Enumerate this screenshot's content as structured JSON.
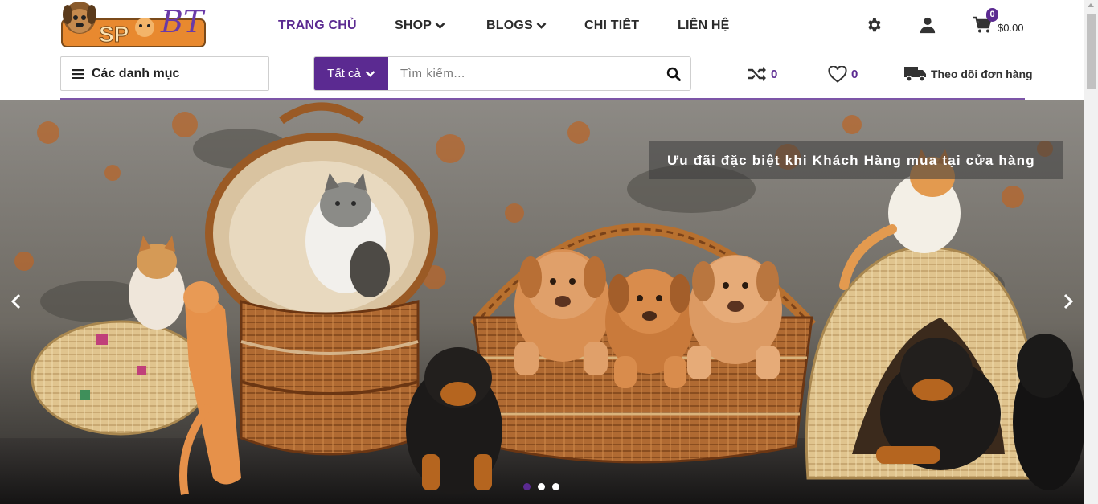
{
  "logo": {
    "text_left": "SP",
    "text_right": "BT"
  },
  "nav": {
    "items": [
      {
        "label": "TRANG CHỦ"
      },
      {
        "label": "SHOP"
      },
      {
        "label": "BLOGS"
      },
      {
        "label": "CHI TIẾT"
      },
      {
        "label": "LIÊN HỆ"
      }
    ]
  },
  "header_icons": {
    "settings": "gear-icon",
    "account": "user-icon",
    "cart": "cart-icon"
  },
  "cart": {
    "count": "0",
    "total": "$0.00"
  },
  "categories": {
    "label": "Các danh mục"
  },
  "search": {
    "scope_label": "Tất cả",
    "placeholder": "Tìm kiếm..."
  },
  "compare": {
    "count": "0"
  },
  "wishlist": {
    "count": "0"
  },
  "tracking": {
    "label": "Theo dõi đơn hàng"
  },
  "hero": {
    "caption": "Ưu đãi đặc biệt khi Khách Hàng mua tại cửa hàng",
    "slide_count": 3,
    "active_slide": 1
  },
  "colors": {
    "accent": "#5b2a91",
    "text": "#222222"
  }
}
